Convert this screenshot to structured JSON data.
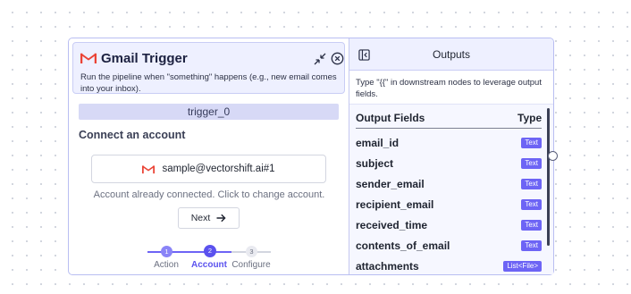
{
  "colors": {
    "accent": "#6d64f5",
    "header_bg": "#eef0ff",
    "border": "#b9bef2",
    "gmail_red": "#ea4335"
  },
  "trigger": {
    "title": "Gmail Trigger",
    "description": "Run the pipeline when \"something\" happens (e.g., new email comes into your inbox).",
    "node_name": "trigger_0",
    "section_label": "Connect an account",
    "account_email": "sample@vectorshift.ai#1",
    "account_hint": "Account already connected. Click to change account.",
    "next_label": "Next",
    "icons": {
      "logo": "gmail-logo-icon",
      "collapse": "collapse-arrows-icon",
      "close": "close-circle-icon",
      "next": "arrow-right-icon"
    }
  },
  "stepper": {
    "steps": [
      {
        "number": "1",
        "label": "Action",
        "state": "complete"
      },
      {
        "number": "2",
        "label": "Account",
        "state": "active"
      },
      {
        "number": "3",
        "label": "Configure",
        "state": "pending"
      }
    ]
  },
  "outputs": {
    "title": "Outputs",
    "description": "Type \"{{\" in downstream nodes to leverage output fields.",
    "fields_header": "Output Fields",
    "type_header": "Type",
    "panel_icon": "sidebar-collapse-icon",
    "fields": [
      {
        "name": "email_id",
        "type": "Text"
      },
      {
        "name": "subject",
        "type": "Text"
      },
      {
        "name": "sender_email",
        "type": "Text"
      },
      {
        "name": "recipient_email",
        "type": "Text"
      },
      {
        "name": "received_time",
        "type": "Text"
      },
      {
        "name": "contents_of_email",
        "type": "Text"
      },
      {
        "name": "attachments",
        "type": "List<File>"
      }
    ]
  }
}
